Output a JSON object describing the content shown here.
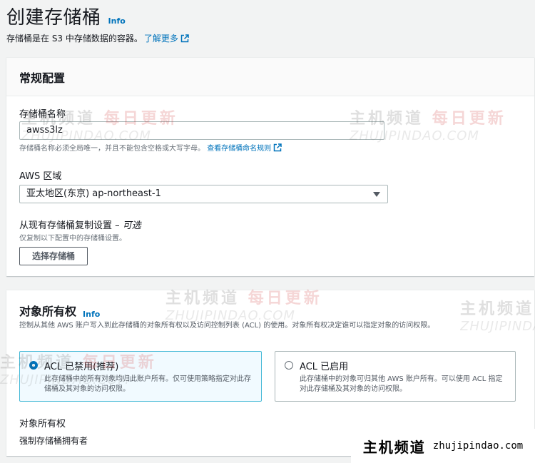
{
  "header": {
    "title": "创建存储桶",
    "info": "Info",
    "description": "存储桶是在 S3 中存储数据的容器。",
    "learn_more": "了解更多"
  },
  "general": {
    "title": "常规配置",
    "bucket_name_label": "存储桶名称",
    "bucket_name_value": "awss3lz",
    "bucket_name_hint": "存储桶名称必须全局唯一，并且不能包含空格或大写字母。",
    "naming_rules_link": "查看存储桶命名规则",
    "region_label": "AWS 区域",
    "region_value": "亚太地区(东京) ap-northeast-1",
    "copy_label": "从现有存储桶复制设置 –",
    "copy_optional": "可选",
    "copy_hint": "仅复制以下配置中的存储桶设置。",
    "choose_bucket_button": "选择存储桶"
  },
  "ownership": {
    "title": "对象所有权",
    "info": "Info",
    "description": "控制从其他 AWS 账户写入到此存储桶的对象所有权以及访问控制列表 (ACL) 的使用。对象所有权决定谁可以指定对象的访问权限。",
    "options": [
      {
        "title": "ACL 已禁用(推荐)",
        "desc": "此存储桶中的所有对象均归此账户所有。仅可使用策略指定对此存储桶及其对象的访问权限。",
        "selected": true
      },
      {
        "title": "ACL 已启用",
        "desc": "此存储桶中的对象可归其他 AWS 账户所有。可以使用 ACL 指定对此存储桶及其对象的访问权限。",
        "selected": false
      }
    ],
    "field_label": "对象所有权",
    "field_value": "强制存储桶拥有者"
  },
  "watermark": {
    "cn_main": "主机频道",
    "cn_red": "每日更新",
    "en": "ZHUJIPINDAO.COM"
  },
  "footer": {
    "brand": "主机频道",
    "url": "zhujipindao.com"
  },
  "colors": {
    "link": "#0073bb",
    "selected_bg": "#f1faff",
    "selected_border": "#44b9d6",
    "page_bg": "#f2f3f3"
  }
}
